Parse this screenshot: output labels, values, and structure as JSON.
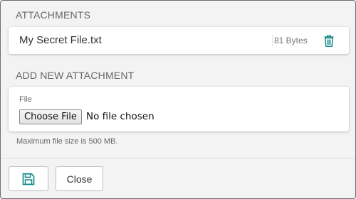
{
  "attachments": {
    "heading": "ATTACHMENTS",
    "items": [
      {
        "name": "My Secret File.txt",
        "size": "81 Bytes",
        "delete_icon": "trash-icon"
      }
    ]
  },
  "new_attachment": {
    "heading": "ADD NEW ATTACHMENT",
    "field_label": "File",
    "choose_label": "Choose File",
    "status": "No file chosen",
    "hint": "Maximum file size is 500 MB."
  },
  "footer": {
    "save_icon": "floppy-disk-icon",
    "close_label": "Close"
  },
  "colors": {
    "accent": "#1a8a8a",
    "background": "#f3f3f3",
    "card": "#ffffff"
  }
}
